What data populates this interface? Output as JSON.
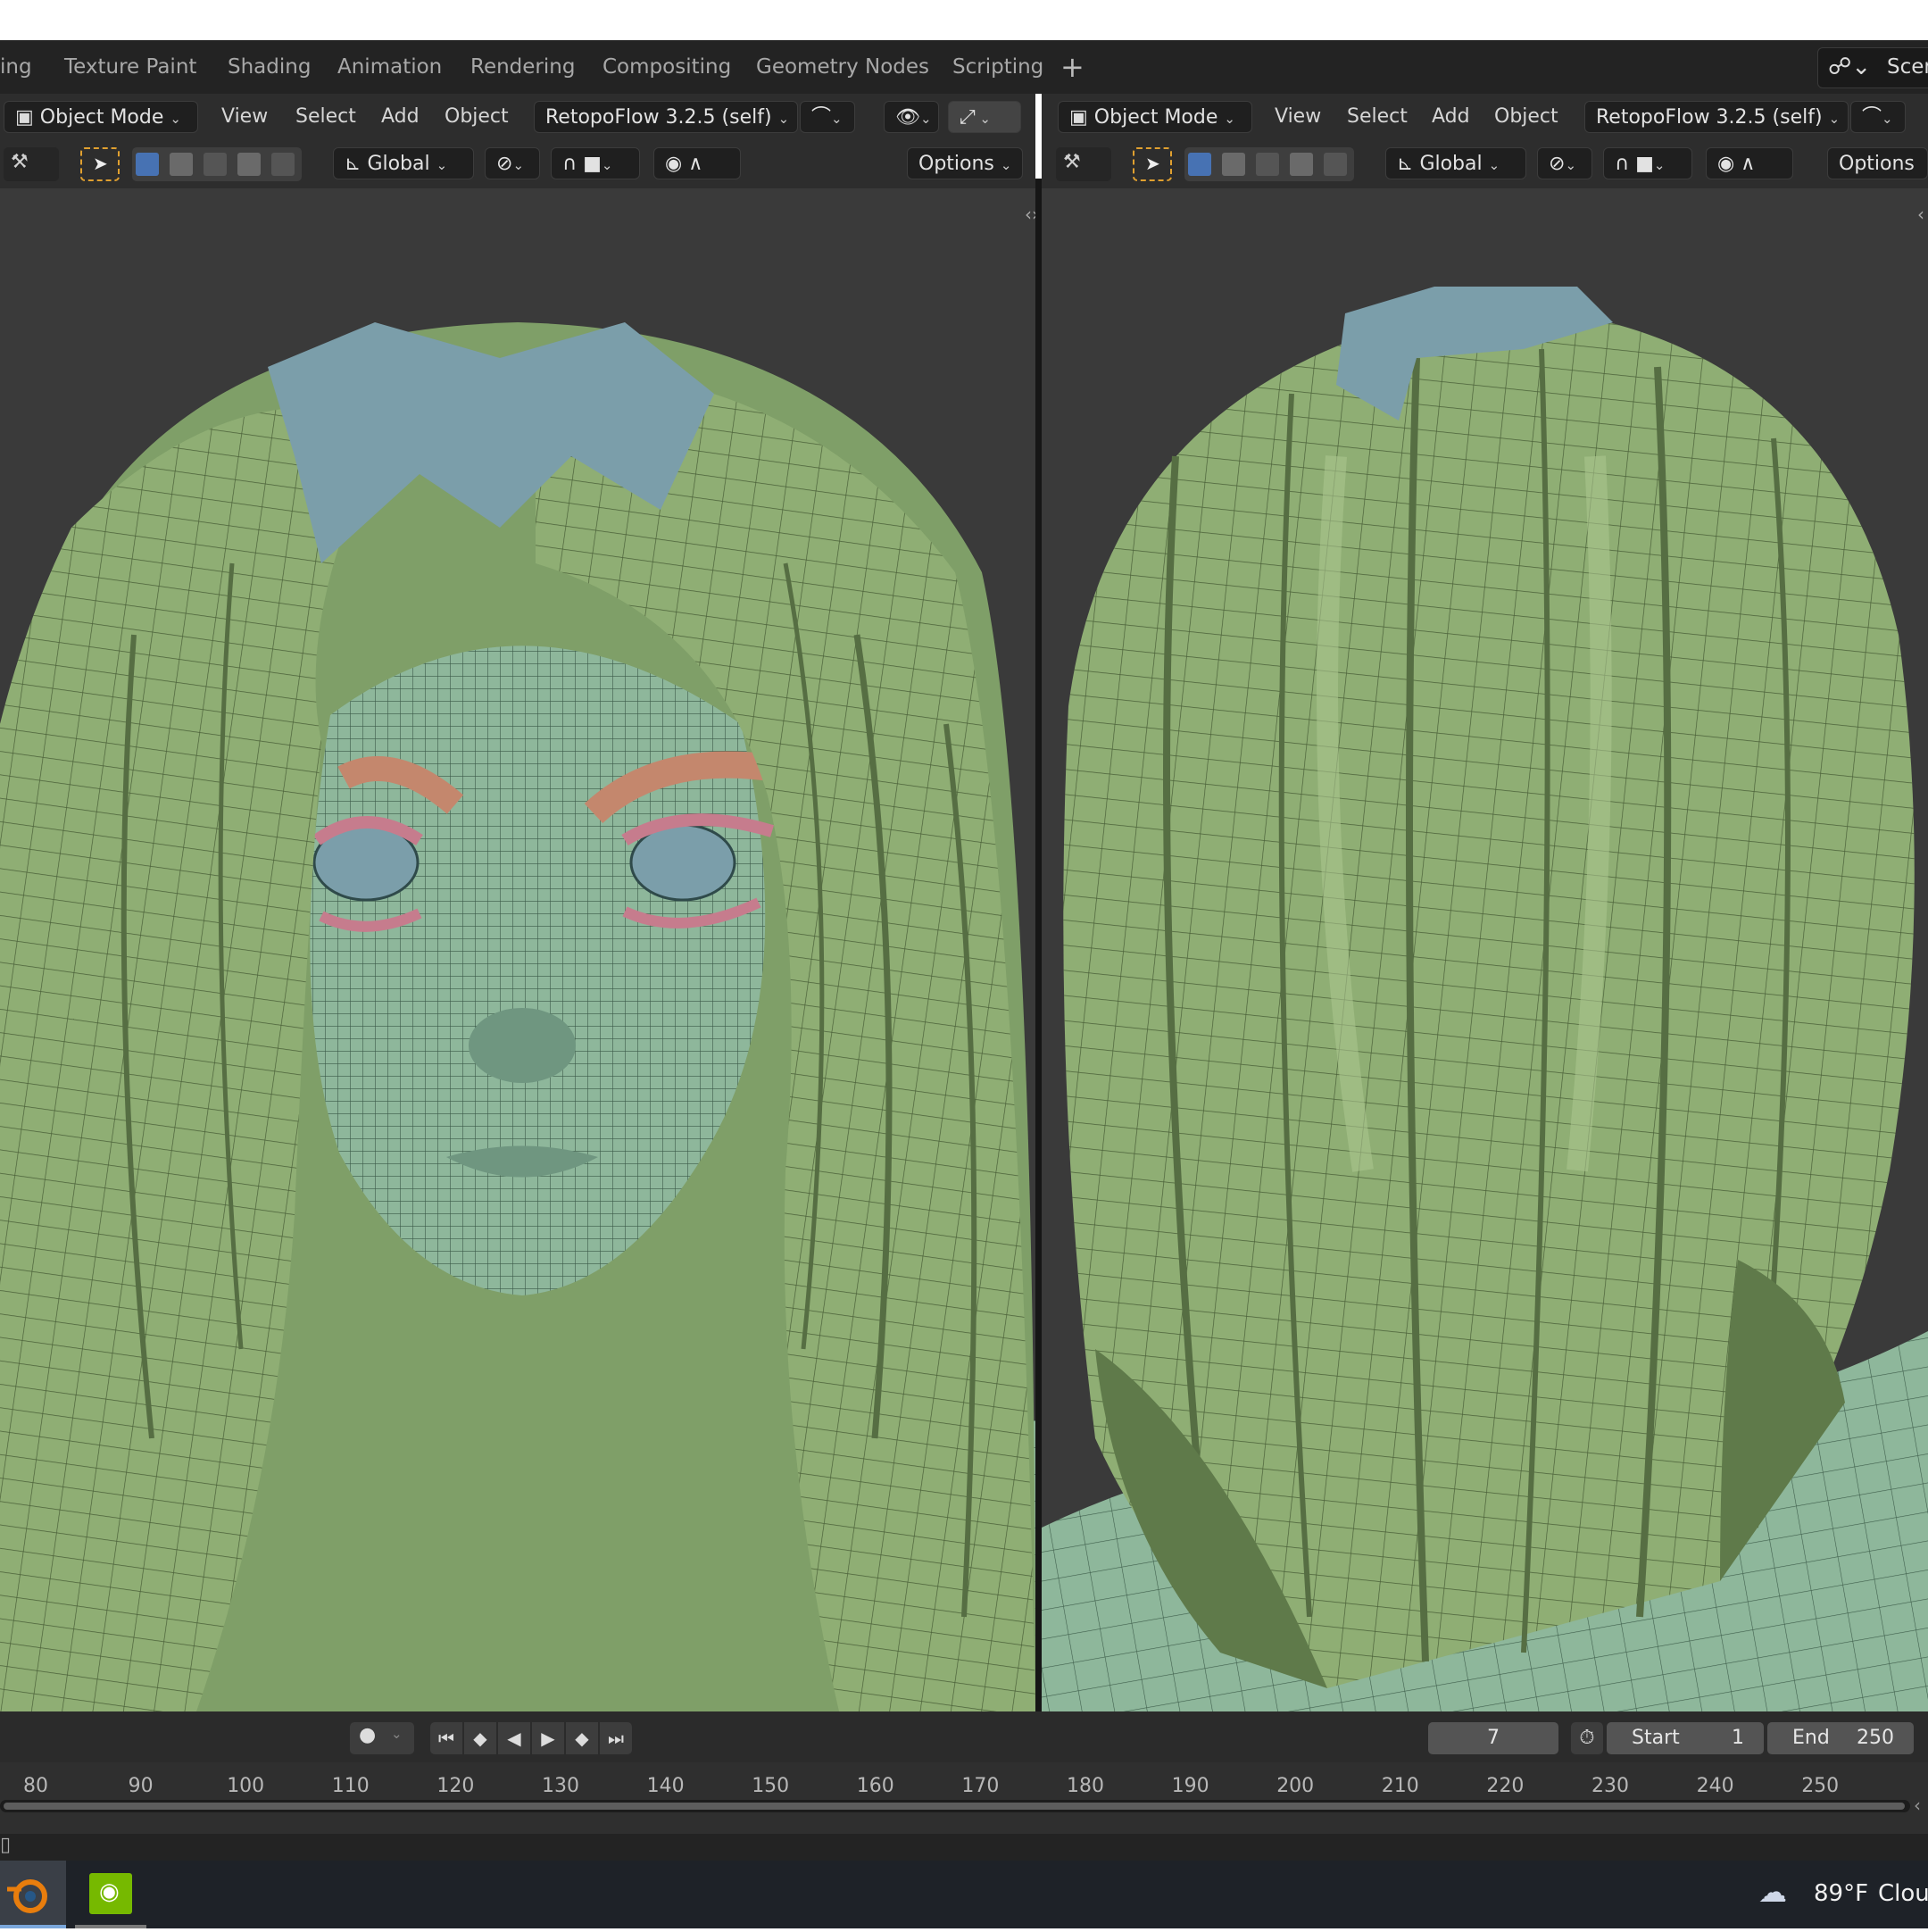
{
  "workspace_tabs": [
    "ing",
    "Texture Paint",
    "Shading",
    "Animation",
    "Rendering",
    "Compositing",
    "Geometry Nodes",
    "Scripting"
  ],
  "add_workspace_glyph": "+",
  "scene_label": "Scen",
  "left_viewport": {
    "mode": "Object Mode",
    "menus": [
      "View",
      "Select",
      "Add",
      "Object"
    ],
    "addon": "RetopoFlow 3.2.5 (self)",
    "transform_orientation": "Global",
    "options": "Options"
  },
  "right_viewport": {
    "mode": "Object Mode",
    "menus": [
      "View",
      "Select",
      "Add",
      "Object"
    ],
    "addon": "RetopoFlow 3.2.5 (self)",
    "transform_orientation": "Global",
    "options": "Options"
  },
  "timeline": {
    "current_frame": "7",
    "start_label": "Start",
    "start_value": "1",
    "end_label": "End",
    "end_value": "250",
    "ruler_ticks": [
      "80",
      "90",
      "100",
      "110",
      "120",
      "130",
      "140",
      "150",
      "160",
      "170",
      "180",
      "190",
      "200",
      "210",
      "220",
      "230",
      "240",
      "250"
    ]
  },
  "taskbar": {
    "weather": "89°F",
    "weather_desc": "Clou",
    "apps": [
      "blender-icon",
      "nvidia-icon"
    ]
  },
  "colors": {
    "hair": "#8fae74",
    "skin": "#8eb79b",
    "scalp": "#7b9eaa",
    "brows": "#c4876d",
    "lashes": "#c67c8d",
    "active": "#4772b3",
    "tool_outline": "#e0a030"
  }
}
